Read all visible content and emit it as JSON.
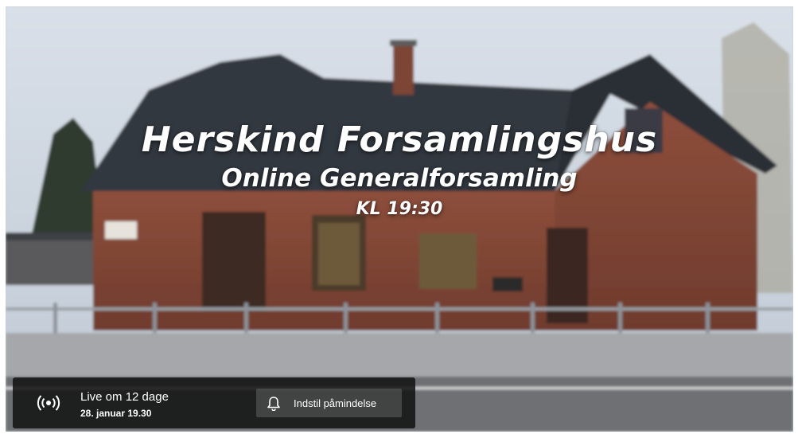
{
  "video": {
    "title_main": "Herskind Forsamlingshus",
    "title_sub": "Online Generalforsamling",
    "title_time": "KL 19:30"
  },
  "live_bar": {
    "status": "Live om 12 dage",
    "date": "28. januar 19.30",
    "reminder_label": "Indstil påmindelse",
    "live_icon": "broadcast-icon",
    "bell_icon": "bell-icon"
  },
  "colors": {
    "bar_background": "#121212",
    "text": "#ffffff",
    "brick": "#8a4a38",
    "roof": "#2b2f36",
    "sky": "#d7dee6"
  }
}
